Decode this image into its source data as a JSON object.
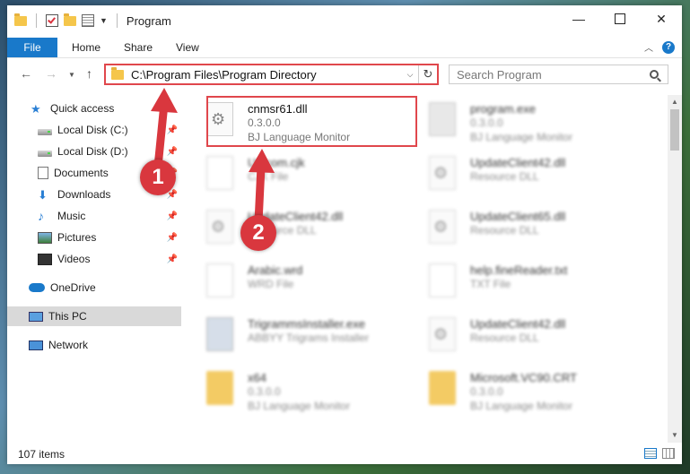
{
  "window": {
    "title": "Program",
    "controls": {
      "minimize": "—",
      "maximize": "",
      "close": "✕"
    }
  },
  "ribbon": {
    "tabs": [
      {
        "label": "File"
      },
      {
        "label": "Home"
      },
      {
        "label": "Share"
      },
      {
        "label": "View"
      }
    ],
    "help": "?"
  },
  "navbar": {
    "address": "C:\\Program Files\\Program Directory",
    "search_placeholder": "Search Program"
  },
  "sidebar": {
    "items": [
      {
        "label": "Quick access",
        "icon": "star-icon"
      },
      {
        "label": "Local Disk (C:)",
        "icon": "disk-icon",
        "pinned": true
      },
      {
        "label": "Local Disk (D:)",
        "icon": "disk-icon",
        "pinned": true
      },
      {
        "label": "Documents",
        "icon": "documents-icon",
        "pinned": true
      },
      {
        "label": "Downloads",
        "icon": "download-icon",
        "pinned": true
      },
      {
        "label": "Music",
        "icon": "music-icon",
        "pinned": true
      },
      {
        "label": "Pictures",
        "icon": "pictures-icon",
        "pinned": true
      },
      {
        "label": "Videos",
        "icon": "videos-icon",
        "pinned": true
      },
      {
        "label": "OneDrive",
        "icon": "cloud-icon"
      },
      {
        "label": "This PC",
        "icon": "pc-icon",
        "selected": true
      },
      {
        "label": "Network",
        "icon": "network-icon"
      }
    ]
  },
  "files": {
    "highlighted": {
      "name": "cnmsr61.dll",
      "version": "0.3.0.0",
      "desc": "BJ Language Monitor"
    },
    "items": [
      {
        "name": "program.exe",
        "sub1": "0.3.0.0",
        "sub2": "BJ Language Monitor"
      },
      {
        "name": "Unicom.cjk",
        "sub1": "CJK File",
        "sub2": ""
      },
      {
        "name": "UpdateClient42.dll",
        "sub1": "Resource DLL",
        "sub2": ""
      },
      {
        "name": "UpdateClient42.dll",
        "sub1": "Resource DLL",
        "sub2": ""
      },
      {
        "name": "UpdateClient65.dll",
        "sub1": "Resource DLL",
        "sub2": ""
      },
      {
        "name": "Arabic.wrd",
        "sub1": "WRD File",
        "sub2": ""
      },
      {
        "name": "help.fineReader.txt",
        "sub1": "TXT File",
        "sub2": ""
      },
      {
        "name": "TrigrammsInstaller.exe",
        "sub1": "ABBYY Trigrams Installer",
        "sub2": ""
      },
      {
        "name": "UpdateClient42.dll",
        "sub1": "Resource DLL",
        "sub2": ""
      },
      {
        "name": "x64",
        "sub1": "0.3.0.0",
        "sub2": "BJ Language Monitor"
      },
      {
        "name": "Microsoft.VC90.CRT",
        "sub1": "0.3.0.0",
        "sub2": "BJ Language Monitor"
      }
    ]
  },
  "status": {
    "count": "107 items"
  },
  "annotations": {
    "step1": "1",
    "step2": "2"
  },
  "colors": {
    "accent": "#1979ca",
    "highlight": "#e0474c",
    "badge": "#d9373e"
  }
}
